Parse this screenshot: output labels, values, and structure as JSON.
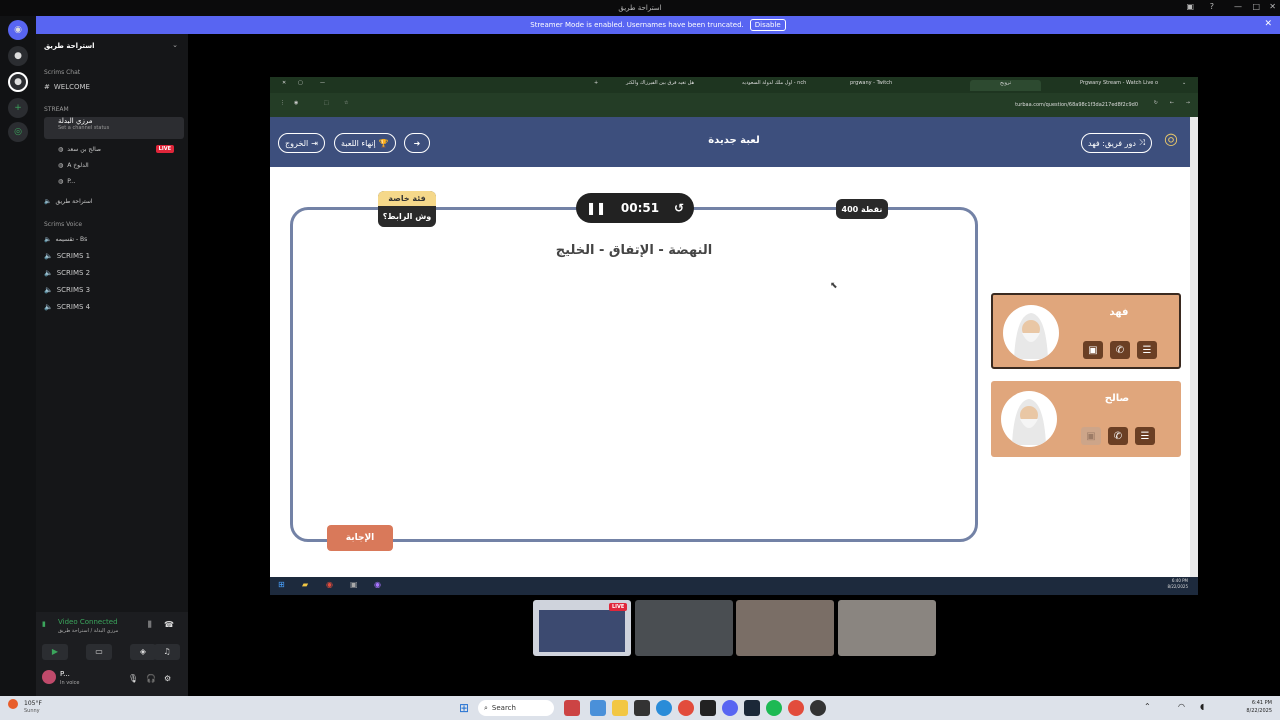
{
  "window": {
    "title": "استراحة طريق"
  },
  "banner": {
    "text": "Streamer Mode is enabled. Usernames have been truncated.",
    "button": "Disable"
  },
  "sidebar": {
    "server_name": "استراحة طريق",
    "cat_scrims_chat": "Scrims Chat",
    "welcome": "WELCOME",
    "cat_stream": "STREAM",
    "stream_channel": "مرزي البدلة",
    "stream_status": "Set a channel status",
    "user1": "صالح بن سعد",
    "live": "LIVE",
    "user2": "A الدلوخ",
    "user3": "P...",
    "channel_rest": "استراحة طريق",
    "cat_voice": "Scrims Voice",
    "voice_rest": "تقسيمه - Bs",
    "scrims": [
      "SCRIMS 1",
      "SCRIMS 2",
      "SCRIMS 3",
      "SCRIMS 4"
    ],
    "video_connected": "Video Connected",
    "video_path": "مرزي البدلة / استراحة طريق",
    "username": "P...",
    "user_status": "In voice"
  },
  "browser": {
    "tabs": [
      "Prgwany Stream - Watch Live o",
      "ترويج",
      "prgwany - Twitch",
      "اول ملك لدولة السعوديه - nch",
      "هل تغيه فرق بين الفيرزاك والكتر"
    ],
    "url": "turbaa.com/question/68a98c1f3da217ed8f2c9d0",
    "header": {
      "title": "لعبة جديدة",
      "exit": "الخروج",
      "end_game": "إنهاء اللعبة",
      "turn": "دور فريق: فهد"
    },
    "category": "فئة خاصة",
    "category_sub": "وش الرابط؟",
    "timer": "00:51",
    "points": "400 نقطة",
    "question": "النهضة - الإتفاق - الخليج",
    "answer": "الإجابة",
    "teams": [
      {
        "name": "فهد"
      },
      {
        "name": "صالح"
      }
    ],
    "inner_clock_time": "6:40 PM",
    "inner_clock_date": "8/22/2025"
  },
  "taskbar": {
    "weather_temp": "105°F",
    "weather_desc": "Sunny",
    "search": "Search",
    "time": "6:41 PM",
    "date": "8/22/2025"
  }
}
